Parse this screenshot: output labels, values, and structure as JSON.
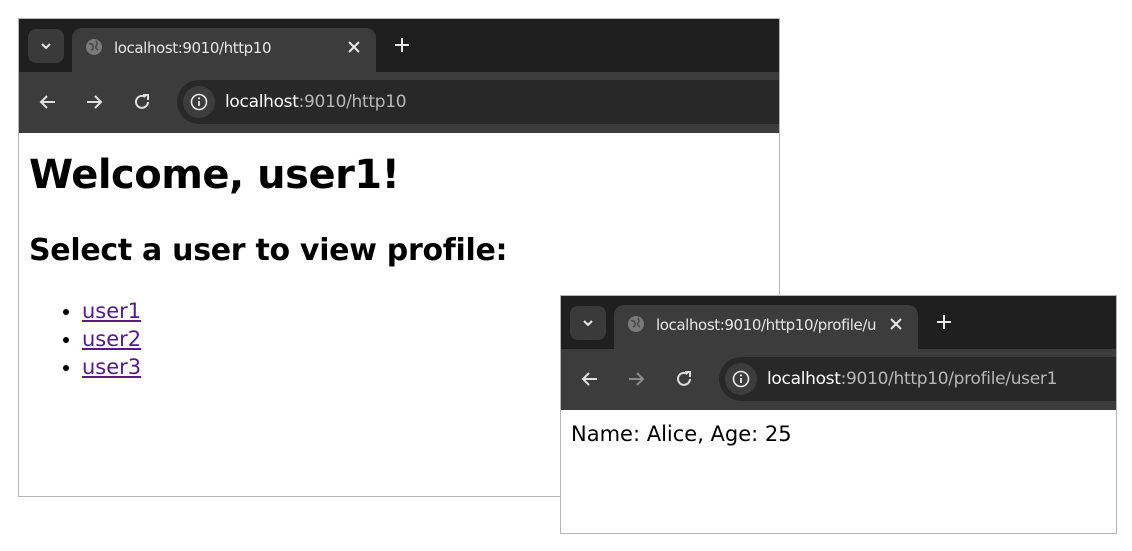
{
  "window1": {
    "tab_title": "localhost:9010/http10",
    "url_host": "localhost",
    "url_path": ":9010/http10",
    "icons": {
      "tab_search": "chevron-down-icon",
      "favicon": "globe-icon",
      "close": "close-icon",
      "new_tab": "plus-icon",
      "back": "arrow-left-icon",
      "forward": "arrow-right-icon",
      "reload": "reload-icon",
      "info": "info-icon"
    },
    "heading": "Welcome, user1!",
    "subheading": "Select a user to view profile:",
    "users": [
      "user1",
      "user2",
      "user3"
    ]
  },
  "window2": {
    "tab_title": "localhost:9010/http10/profile/u",
    "url_host": "localhost",
    "url_path": ":9010/http10/profile/user1",
    "icons": {
      "tab_search": "chevron-down-icon",
      "favicon": "globe-icon",
      "close": "close-icon",
      "new_tab": "plus-icon",
      "back": "arrow-left-icon",
      "forward": "arrow-right-icon",
      "reload": "reload-icon",
      "info": "info-icon"
    },
    "profile_text": "Name: Alice, Age: 25"
  },
  "colors": {
    "tabstrip_bg": "#1f1f1f",
    "toolbar_bg": "#3c3c3c",
    "omnibox_bg": "#282828",
    "visited_link": "#551a8b"
  }
}
